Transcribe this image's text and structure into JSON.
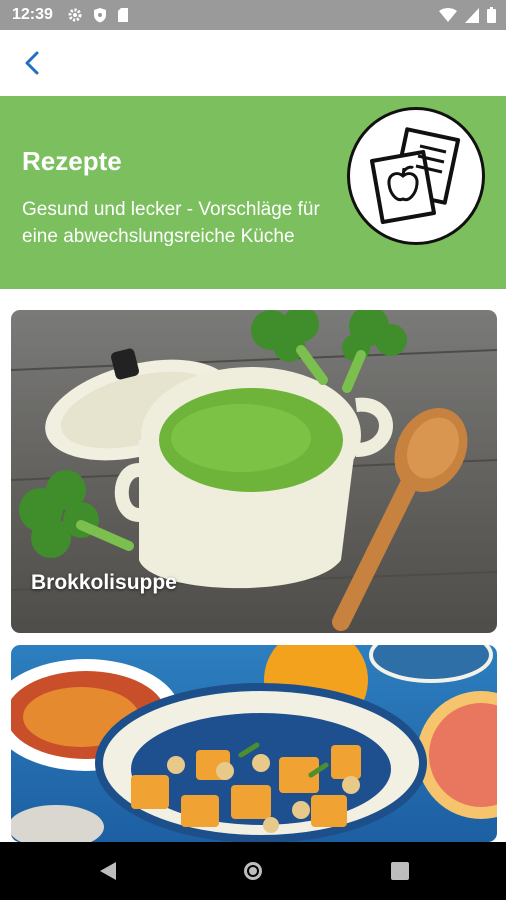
{
  "status_bar": {
    "time": "12:39",
    "icons_left": [
      "gear-icon",
      "shield-icon",
      "sd-card-icon"
    ],
    "icons_right": [
      "wifi-icon",
      "signal-icon",
      "battery-icon"
    ]
  },
  "app_bar": {
    "back_icon": "chevron-left-icon",
    "accent_color": "#1f6fc2"
  },
  "header": {
    "title": "Rezepte",
    "subtitle": "Gesund und lecker - Vorschläge für eine abwechslungsreiche Küche",
    "background": "#7bbf5e",
    "badge_icon": "recipe-cards-apple-icon"
  },
  "recipes": [
    {
      "title": "Brokkolisuppe"
    },
    {
      "title": ""
    }
  ],
  "nav_bar": {
    "buttons": [
      "back-triangle-icon",
      "home-circle-icon",
      "recents-square-icon"
    ]
  }
}
